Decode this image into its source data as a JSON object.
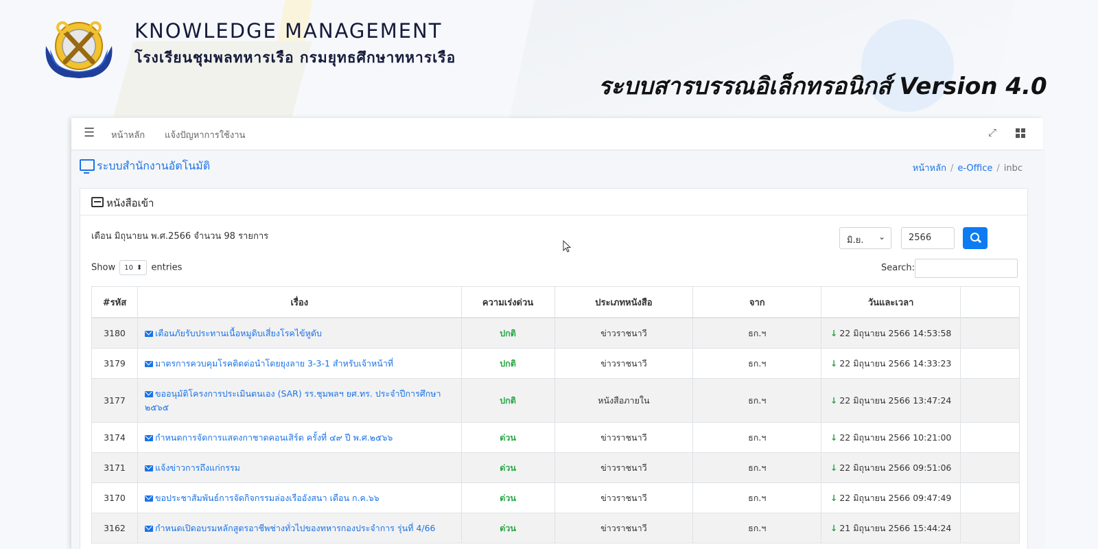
{
  "brand": {
    "title": "KNOWLEDGE MANAGEMENT",
    "subtitle": "โรงเรียนชุมพลทหารเรือ กรมยุทธศึกษาทหารเรือ",
    "system_title": "ระบบสารบรรณอิเล็กทรอนิกส์ Version 4.0"
  },
  "topnav": {
    "links": [
      "หน้าหลัก",
      "แจ้งปัญหาการใช้งาน"
    ]
  },
  "page": {
    "heading": "ระบบสำนักงานอัตโนมัติ",
    "breadcrumb": [
      "หน้าหลัก",
      "e-Office",
      "inbc"
    ]
  },
  "card": {
    "title": "หนังสือเข้า",
    "summary": "เดือน มิถุนายน พ.ศ.2566 จำนวน 98 รายการ",
    "month_value": "มิ.ย.",
    "year_value": "2566",
    "show_label": "Show",
    "entries_value": "10",
    "entries_label": "entries",
    "search_label": "Search:"
  },
  "table": {
    "headers": [
      "#รหัส",
      "เรื่อง",
      "ความเร่งด่วน",
      "ประเภทหนังสือ",
      "จาก",
      "วันและเวลา",
      ""
    ],
    "rows": [
      {
        "id": "3180",
        "subject": "เตือนภัยรับประทานเนื้อหมูดิบเสี่ยงโรคไข้หูดับ",
        "urgency": "ปกติ",
        "type": "ข่าวราชนาวี",
        "from": "ธก.ฯ",
        "date": "22 มิถุนายน 2566 14:53:58"
      },
      {
        "id": "3179",
        "subject": "มาตรการควบคุมโรคติดต่อนำโดยยุงลาย 3-3-1 สำหรับเจ้าหน้าที่",
        "urgency": "ปกติ",
        "type": "ข่าวราชนาวี",
        "from": "ธก.ฯ",
        "date": "22 มิถุนายน 2566 14:33:23"
      },
      {
        "id": "3177",
        "subject": "ขออนุมัติโครงการประเมินตนเอง (SAR) รร.ชุมพลฯ ยศ.ทร. ประจำปีการศึกษา ๒๕๖๕",
        "urgency": "ปกติ",
        "type": "หนังสือภายใน",
        "from": "ธก.ฯ",
        "date": "22 มิถุนายน 2566 13:47:24"
      },
      {
        "id": "3174",
        "subject": "กำหนดการจัดการแสดงกาชาดคอนเสิร์ต ครั้งที่ ๔๙ ปี พ.ศ.๒๕๖๖",
        "urgency": "ด่วน",
        "type": "ข่าวราชนาวี",
        "from": "ธก.ฯ",
        "date": "22 มิถุนายน 2566 10:21:00"
      },
      {
        "id": "3171",
        "subject": "แจ้งข่าวการถึงแก่กรรม",
        "urgency": "ด่วน",
        "type": "ข่าวราชนาวี",
        "from": "ธก.ฯ",
        "date": "22 มิถุนายน 2566 09:51:06"
      },
      {
        "id": "3170",
        "subject": "ขอประชาสัมพันธ์การจัดกิจกรรมล่องเรืออังสนา เดือน ก.ค.๖๖",
        "urgency": "ด่วน",
        "type": "ข่าวราชนาวี",
        "from": "ธก.ฯ",
        "date": "22 มิถุนายน 2566 09:47:49"
      },
      {
        "id": "3162",
        "subject": "กำหนดเปิดอบรมหลักสูตรอาชีพช่างทั่วไปของทหารกองประจำการ รุ่นที่ 4/66",
        "urgency": "ด่วน",
        "type": "ข่าวราชนาวี",
        "from": "ธก.ฯ",
        "date": "21 มิถุนายน 2566 15:44:24"
      }
    ]
  },
  "colors": {
    "accent": "#1a73e8",
    "urgency": "#28a745",
    "search_button": "#0d7bf2"
  }
}
